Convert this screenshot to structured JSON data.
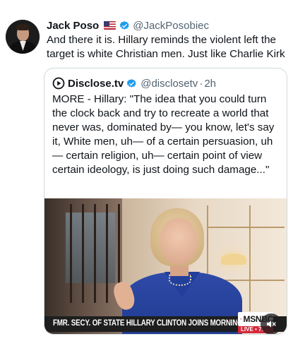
{
  "tweet": {
    "author_name": "Jack Poso",
    "author_handle": "@JackPosobiec",
    "text": "And there it is. Hillary reminds the violent left the target is white Christian men. Just like Charlie Kirk",
    "flag_icon": "us-flag-icon",
    "verified_color": "#1d9bf0"
  },
  "quoted": {
    "source_name": "Disclose.tv",
    "source_handle": "@disclosetv",
    "time": "2h",
    "text": "MORE - Hillary: \"The idea that you could turn the clock back and try to recreate a world that never was, dominated by— you know, let's say it, White men, uh— of a certain persuasion, uh— certain religion, uh— certain point of view certain ideology, is just doing such damage...\"",
    "video": {
      "chyron": "FMR. SECY. OF STATE HILLARY CLINTON JOINS MORNING JOE",
      "network": "MSNBC",
      "live_label": "LIVE • 7:",
      "live_color": "#d6283a"
    }
  }
}
